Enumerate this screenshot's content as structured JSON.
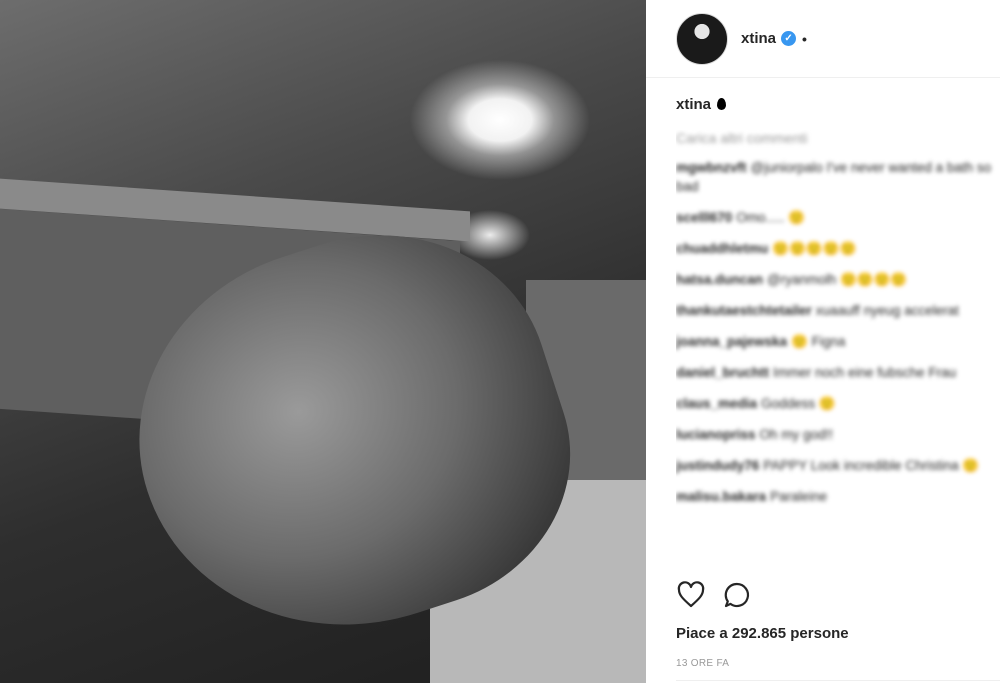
{
  "post": {
    "image_alt": "black-and-white bath photo",
    "username": "xtina",
    "verified_icon": "verified-badge-icon",
    "more_dot": "•",
    "caption_user": "xtina",
    "caption_emoji_icon": "black-drop-icon",
    "load_more": "Carica altri commenti",
    "comments": [
      {
        "user": "mgwbnzvft",
        "text": "@juniorpalo I've never wanted a bath so bad"
      },
      {
        "user": "scelll670",
        "text": "Omo..... 🙂"
      },
      {
        "user": "chuaddhletmu",
        "text": "🙂🙂🙂🙂🙂"
      },
      {
        "user": "hatsa.duncan",
        "text": "@ryanmolh 🙂🙂🙂🙂"
      },
      {
        "user": "thankutaestchtetailer",
        "text": "xuaauff nyeug accelerat"
      },
      {
        "user": "joanna_pajewska",
        "text": "🙂 Figna"
      },
      {
        "user": "daniel_bruchtt",
        "text": "Immer noch eine fubsche Frau"
      },
      {
        "user": "claus_media",
        "text": "Goddess 🙂"
      },
      {
        "user": "lucianopriss",
        "text": "Oh my god!!"
      },
      {
        "user": "justindudy76",
        "text": "PAPPY Look incredible Christina 🙂"
      },
      {
        "user": "malisu.bakara",
        "text": "Paraleine"
      }
    ],
    "likes_text": "Piace a 292.865 persone",
    "time_text": "13 ORE FA",
    "icons": {
      "like": "heart-icon",
      "comment": "comment-bubble-icon"
    }
  }
}
